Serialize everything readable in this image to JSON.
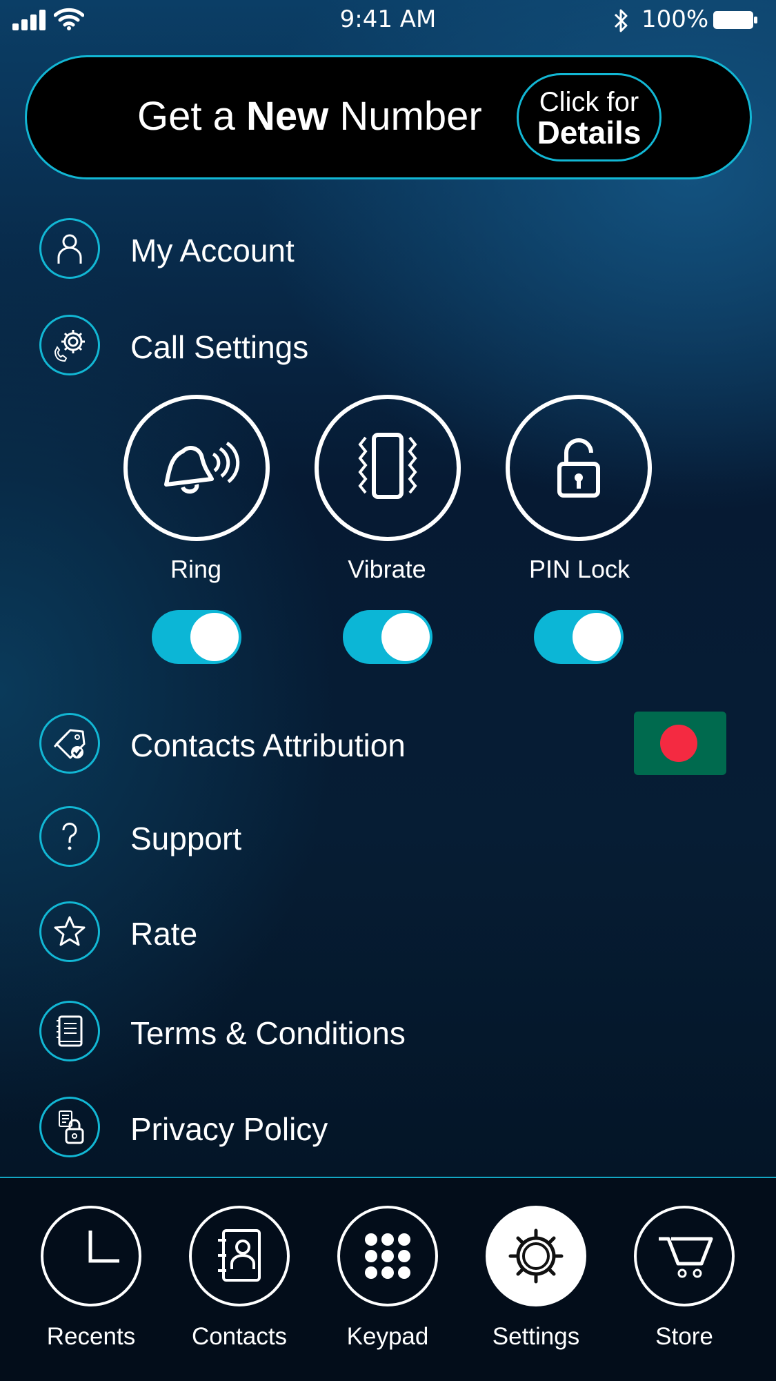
{
  "status_bar": {
    "time": "9:41 AM",
    "battery": "100%"
  },
  "promo": {
    "text_prefix": "Get a ",
    "text_bold": "New",
    "text_suffix": " Number",
    "button_line1": "Click for",
    "button_line2": "Details"
  },
  "menu": {
    "my_account": "My Account",
    "call_settings": "Call Settings",
    "contacts_attribution": "Contacts Attribution",
    "support": "Support",
    "rate": "Rate",
    "terms": "Terms & Conditions",
    "privacy": "Privacy Policy"
  },
  "call_settings": [
    {
      "label": "Ring",
      "enabled": true
    },
    {
      "label": "Vibrate",
      "enabled": true
    },
    {
      "label": "PIN Lock",
      "enabled": true
    }
  ],
  "tabs": [
    {
      "label": "Recents",
      "icon": "clock-icon",
      "active": false
    },
    {
      "label": "Contacts",
      "icon": "contacts-book-icon",
      "active": false
    },
    {
      "label": "Keypad",
      "icon": "keypad-icon",
      "active": false
    },
    {
      "label": "Settings",
      "icon": "settings-gear-icon",
      "active": true
    },
    {
      "label": "Store",
      "icon": "cart-icon",
      "active": false
    }
  ],
  "colors": {
    "accent": "#12b7d4",
    "toggle_on": "#0cb6d6",
    "flag_green": "#006a4e",
    "flag_red": "#f42a41"
  }
}
